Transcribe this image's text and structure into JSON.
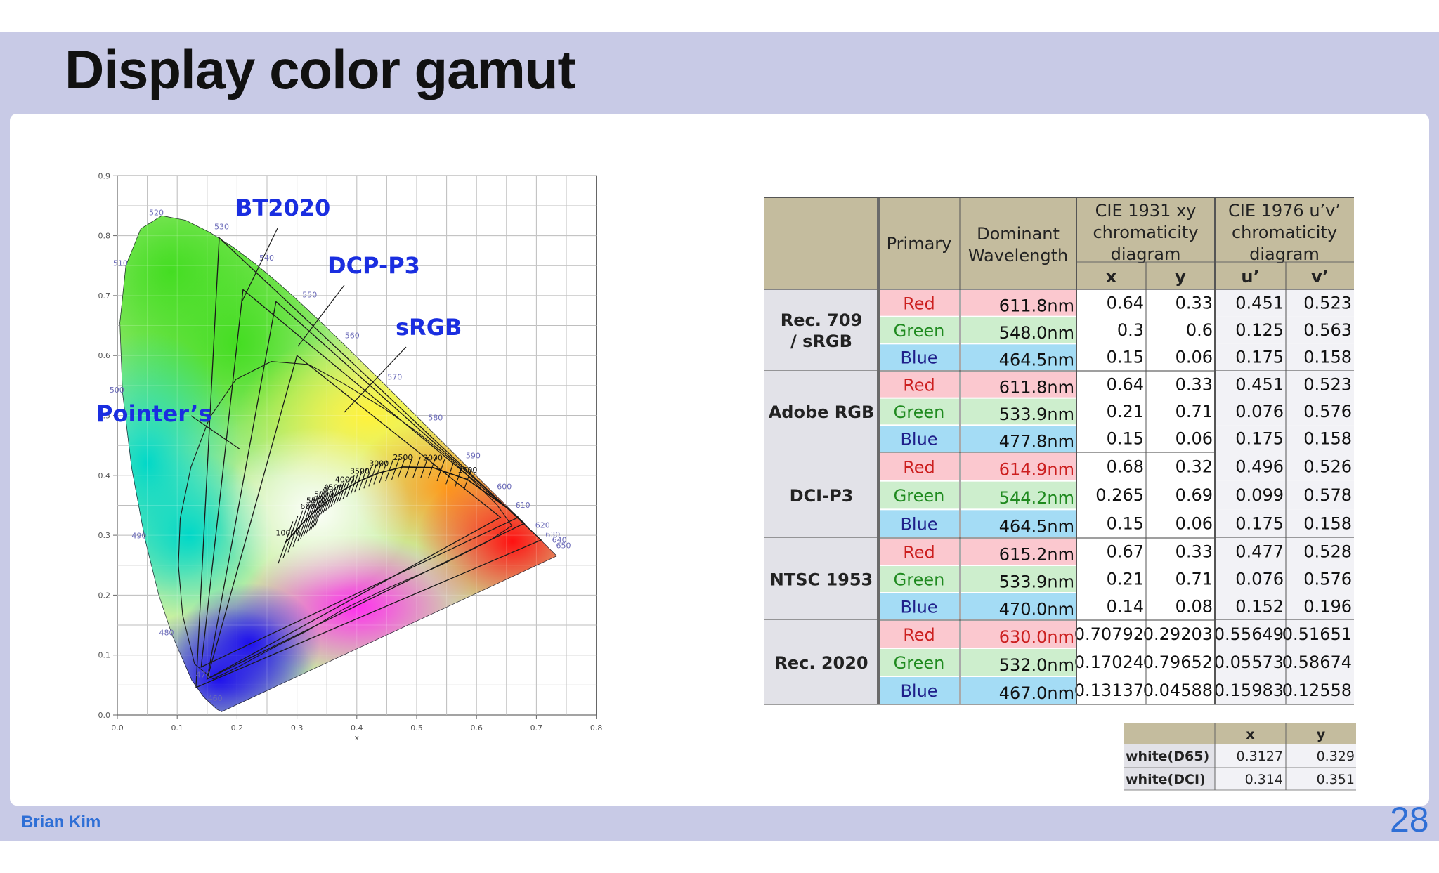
{
  "title": "Display color gamut",
  "footer": {
    "author": "Brian Kim",
    "page": "28"
  },
  "diagram": {
    "x_ticks": [
      "0.0",
      "0.1",
      "0.2",
      "0.3",
      "0.4",
      "0.5",
      "0.6",
      "0.7",
      "0.8"
    ],
    "y_ticks": [
      "0.0",
      "0.1",
      "0.2",
      "0.3",
      "0.4",
      "0.5",
      "0.6",
      "0.7",
      "0.8",
      "0.9"
    ],
    "x_axis_label": "x",
    "gamut_labels": [
      "BT2020",
      "DCP-P3",
      "sRGB",
      "Pointer's"
    ],
    "wavelength_labels": [
      {
        "text": "460",
        "x": 0.144,
        "y": 0.019
      },
      {
        "text": "470",
        "x": 0.124,
        "y": 0.058
      },
      {
        "text": "480",
        "x": 0.091,
        "y": 0.133
      },
      {
        "text": "490",
        "x": 0.045,
        "y": 0.295
      },
      {
        "text": "500",
        "x": 0.008,
        "y": 0.538
      },
      {
        "text": "510",
        "x": 0.014,
        "y": 0.75
      },
      {
        "text": "520",
        "x": 0.074,
        "y": 0.834
      },
      {
        "text": "530",
        "x": 0.155,
        "y": 0.806
      },
      {
        "text": "540",
        "x": 0.23,
        "y": 0.754
      },
      {
        "text": "550",
        "x": 0.302,
        "y": 0.692
      },
      {
        "text": "560",
        "x": 0.373,
        "y": 0.624
      },
      {
        "text": "570",
        "x": 0.444,
        "y": 0.555
      },
      {
        "text": "580",
        "x": 0.512,
        "y": 0.487
      },
      {
        "text": "590",
        "x": 0.575,
        "y": 0.424
      },
      {
        "text": "600",
        "x": 0.627,
        "y": 0.372
      },
      {
        "text": "610",
        "x": 0.658,
        "y": 0.341
      },
      {
        "text": "620",
        "x": 0.691,
        "y": 0.308
      },
      {
        "text": "630",
        "x": 0.708,
        "y": 0.292
      },
      {
        "text": "640",
        "x": 0.719,
        "y": 0.283
      },
      {
        "text": "650",
        "x": 0.726,
        "y": 0.274
      }
    ],
    "cct_labels": [
      {
        "text": "10000",
        "x": 0.281,
        "y": 0.288
      },
      {
        "text": "6000",
        "x": 0.322,
        "y": 0.332
      },
      {
        "text": "5500",
        "x": 0.332,
        "y": 0.342
      },
      {
        "text": "5000",
        "x": 0.345,
        "y": 0.352
      },
      {
        "text": "4500",
        "x": 0.361,
        "y": 0.364
      },
      {
        "text": "4000",
        "x": 0.38,
        "y": 0.377
      },
      {
        "text": "3500",
        "x": 0.405,
        "y": 0.391
      },
      {
        "text": "3000",
        "x": 0.437,
        "y": 0.404
      },
      {
        "text": "2500",
        "x": 0.477,
        "y": 0.414
      },
      {
        "text": "2000",
        "x": 0.527,
        "y": 0.413
      },
      {
        "text": "1500",
        "x": 0.585,
        "y": 0.393
      }
    ]
  },
  "table": {
    "headers": {
      "primary": "Primary",
      "dominant": [
        "Dominant",
        "Wavelength"
      ],
      "cie1931": [
        "CIE 1931 xy",
        "chromaticity",
        "diagram"
      ],
      "cie1976": [
        "CIE 1976 u’v’",
        "chromaticity",
        "diagram"
      ],
      "x": "x",
      "y": "y",
      "u": "u’",
      "v": "v’"
    },
    "groups": [
      {
        "name": [
          "Rec. 709",
          "/ sRGB"
        ],
        "rows": [
          {
            "primary": "Red",
            "wl": "611.8nm",
            "wl_red": false,
            "x": "0.64",
            "y": "0.33",
            "u": "0.451",
            "v": "0.523"
          },
          {
            "primary": "Green",
            "wl": "548.0nm",
            "wl_red": false,
            "x": "0.3",
            "y": "0.6",
            "u": "0.125",
            "v": "0.563"
          },
          {
            "primary": "Blue",
            "wl": "464.5nm",
            "wl_red": false,
            "x": "0.15",
            "y": "0.06",
            "u": "0.175",
            "v": "0.158"
          }
        ]
      },
      {
        "name": [
          "Adobe RGB"
        ],
        "rows": [
          {
            "primary": "Red",
            "wl": "611.8nm",
            "wl_red": false,
            "x": "0.64",
            "y": "0.33",
            "u": "0.451",
            "v": "0.523"
          },
          {
            "primary": "Green",
            "wl": "533.9nm",
            "wl_red": false,
            "x": "0.21",
            "y": "0.71",
            "u": "0.076",
            "v": "0.576"
          },
          {
            "primary": "Blue",
            "wl": "477.8nm",
            "wl_red": false,
            "x": "0.15",
            "y": "0.06",
            "u": "0.175",
            "v": "0.158"
          }
        ]
      },
      {
        "name": [
          "DCI-P3"
        ],
        "rows": [
          {
            "primary": "Red",
            "wl": "614.9nm",
            "wl_red": true,
            "x": "0.68",
            "y": "0.32",
            "u": "0.496",
            "v": "0.526"
          },
          {
            "primary": "Green",
            "wl": "544.2nm",
            "wl_green": true,
            "x": "0.265",
            "y": "0.69",
            "u": "0.099",
            "v": "0.578"
          },
          {
            "primary": "Blue",
            "wl": "464.5nm",
            "wl_red": false,
            "x": "0.15",
            "y": "0.06",
            "u": "0.175",
            "v": "0.158"
          }
        ]
      },
      {
        "name": [
          "NTSC 1953"
        ],
        "rows": [
          {
            "primary": "Red",
            "wl": "615.2nm",
            "wl_red": false,
            "x": "0.67",
            "y": "0.33",
            "u": "0.477",
            "v": "0.528"
          },
          {
            "primary": "Green",
            "wl": "533.9nm",
            "wl_red": false,
            "x": "0.21",
            "y": "0.71",
            "u": "0.076",
            "v": "0.576"
          },
          {
            "primary": "Blue",
            "wl": "470.0nm",
            "wl_red": false,
            "x": "0.14",
            "y": "0.08",
            "u": "0.152",
            "v": "0.196"
          }
        ]
      },
      {
        "name": [
          "Rec. 2020"
        ],
        "rows": [
          {
            "primary": "Red",
            "wl": "630.0nm",
            "wl_red": true,
            "x": "0.70792",
            "y": "0.29203",
            "u": "0.55649",
            "v": "0.51651"
          },
          {
            "primary": "Green",
            "wl": "532.0nm",
            "wl_red": false,
            "x": "0.17024",
            "y": "0.79652",
            "u": "0.05573",
            "v": "0.58674"
          },
          {
            "primary": "Blue",
            "wl": "467.0nm",
            "wl_red": false,
            "x": "0.13137",
            "y": "0.04588",
            "u": "0.15983",
            "v": "0.12558"
          }
        ]
      }
    ]
  },
  "white_table": {
    "headers": {
      "x": "x",
      "y": "y"
    },
    "rows": [
      {
        "name": "white(D65)",
        "x": "0.3127",
        "y": "0.329"
      },
      {
        "name": "white(DCI)",
        "x": "0.314",
        "y": "0.351"
      }
    ]
  },
  "colors": {
    "band": "#c8cae6",
    "accent": "#2f6fd6",
    "gamut_label": "#1a2ee0",
    "header_bg": "#c4bc9e",
    "name_bg": "#e2e2e8",
    "red_bg": "#fbc8cf",
    "green_bg": "#cdeecd",
    "blue_bg": "#a4dcf5",
    "num_bg": "#f2f2f6"
  }
}
